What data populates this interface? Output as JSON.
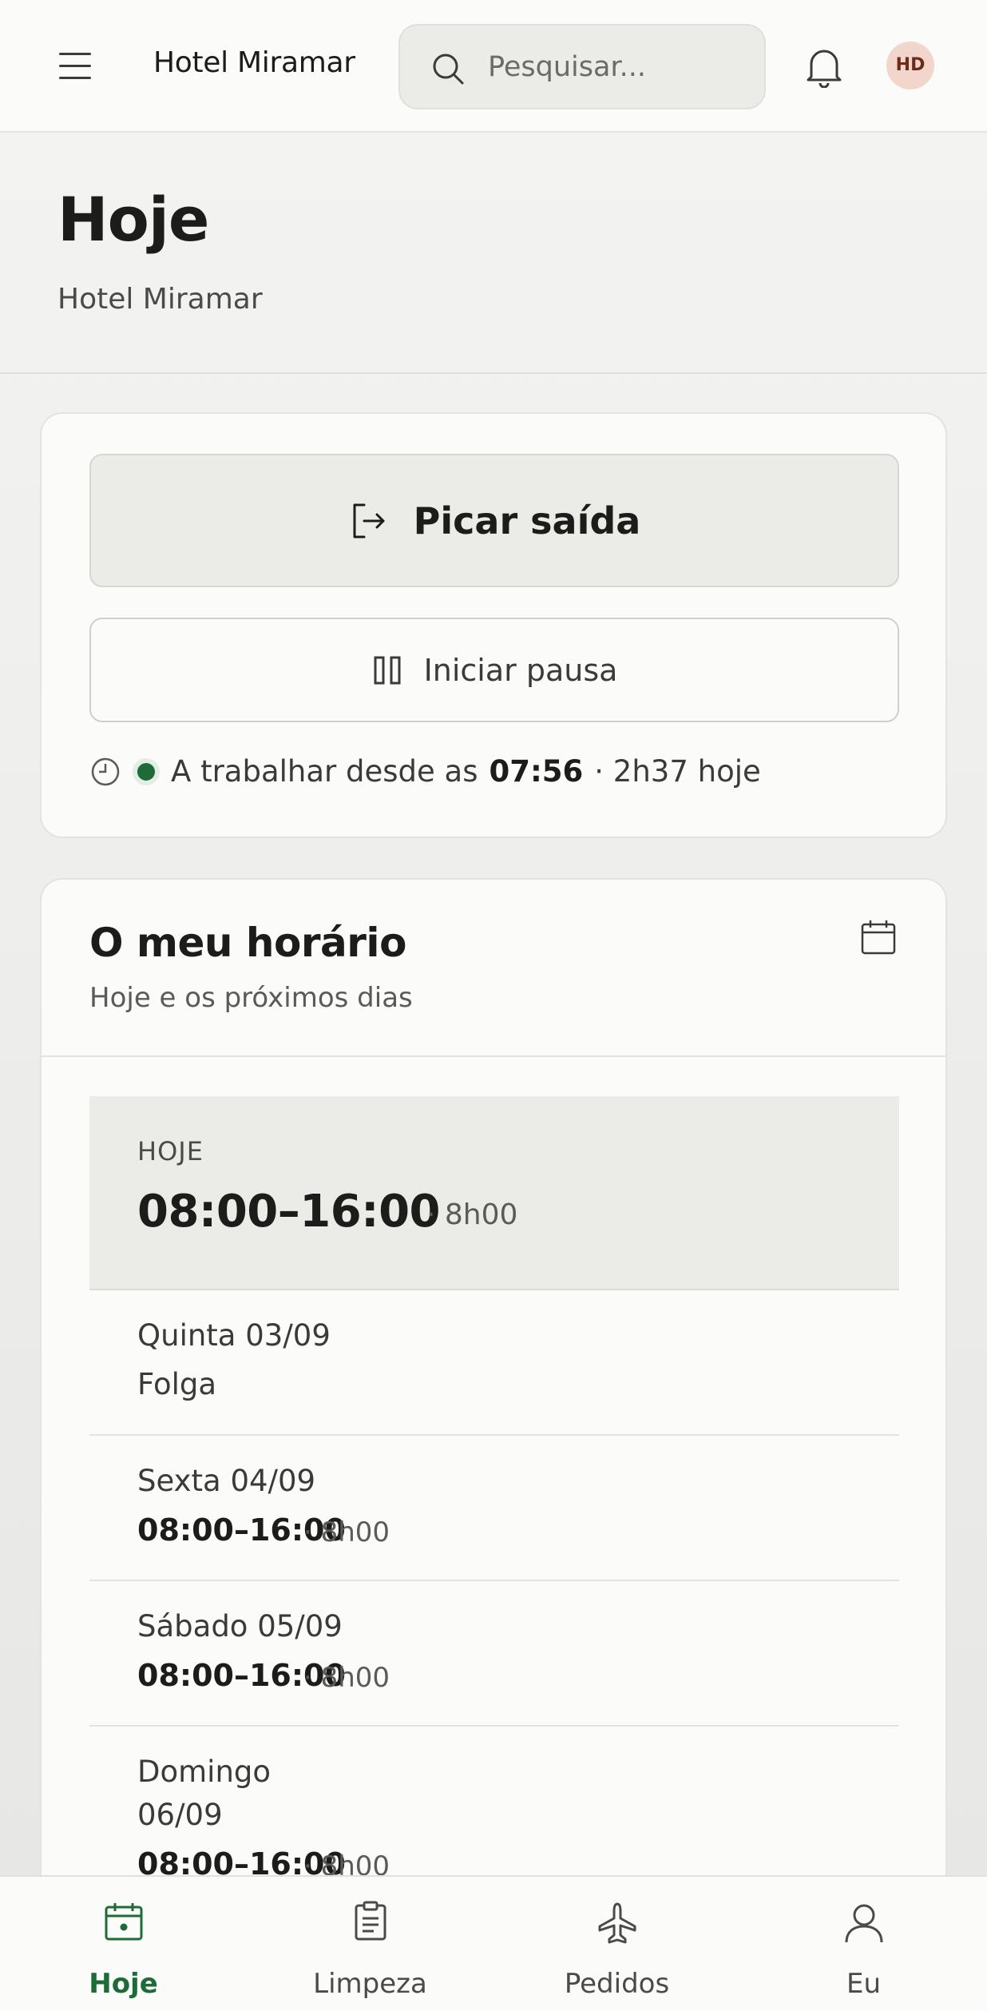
{
  "topbar": {
    "title": "Hotel Miramar",
    "search_placeholder": "Pesquisar...",
    "avatar_initials": "HD"
  },
  "header": {
    "title": "Hoje",
    "subtitle": "Hotel Miramar"
  },
  "clock": {
    "primary_label": "Picar saída",
    "secondary_label": "Iniciar pausa",
    "status_prefix": "A trabalhar desde as",
    "status_time": "07:56",
    "status_suffix": "· 2h37 hoje",
    "status_color": "#1d6b36"
  },
  "schedule": {
    "title": "O meu horário",
    "subtitle": "Hoje e os próximos dias",
    "today": {
      "label": "HOJE",
      "time": "08:00–16:00",
      "hours": "· 8h00"
    },
    "days": [
      {
        "name": "Quinta 03/09",
        "off": "Folga"
      },
      {
        "name": "Sexta 04/09",
        "time": "08:00–16:00",
        "hours": "· 8h00"
      },
      {
        "name": "Sábado 05/09",
        "time": "08:00–16:00",
        "hours": "· 8h00"
      },
      {
        "name_line1": "Domingo",
        "name_line2": "06/09",
        "time": "08:00–16:00",
        "hours": "· 8h00"
      }
    ]
  },
  "nav": {
    "items": [
      {
        "label": "Hoje",
        "icon": "calendar-icon",
        "active": true
      },
      {
        "label": "Limpeza",
        "icon": "clipboard-icon"
      },
      {
        "label": "Pedidos",
        "icon": "plane-icon"
      },
      {
        "label": "Eu",
        "icon": "user-icon"
      }
    ],
    "accent_color": "#1d6b36"
  }
}
